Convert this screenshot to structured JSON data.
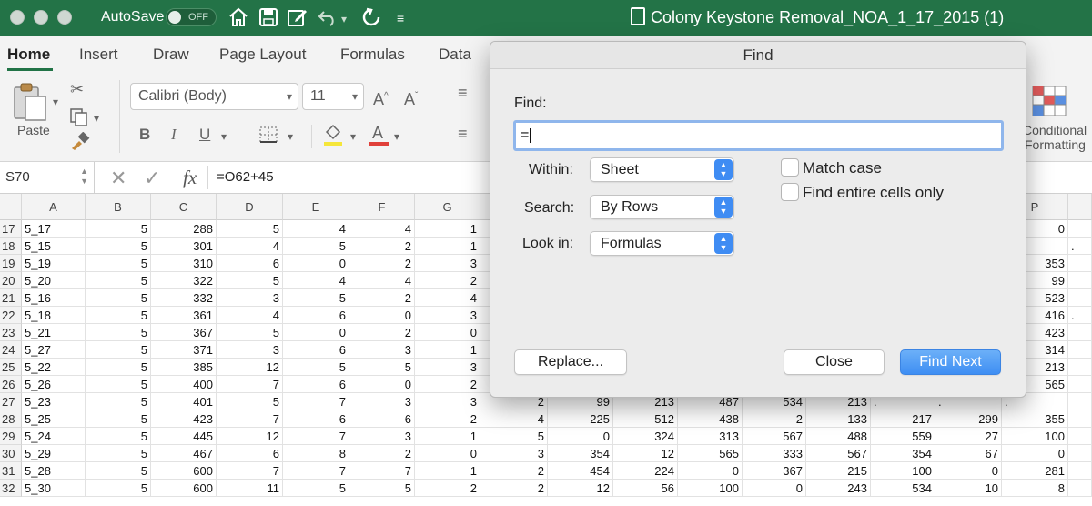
{
  "titlebar": {
    "autosave_label": "AutoSave",
    "autosave_state": "OFF",
    "document_title": "Colony Keystone Removal_NOA_1_17_2015 (1)",
    "icons": [
      "home-icon",
      "save-icon",
      "edit-icon",
      "undo-icon",
      "redo-icon",
      "customize-icon"
    ]
  },
  "ribbon": {
    "tabs": [
      "Home",
      "Insert",
      "Draw",
      "Page Layout",
      "Formulas",
      "Data"
    ],
    "active_tab": "Home",
    "paste_label": "Paste",
    "font_name": "Calibri (Body)",
    "font_size": "11",
    "bold": "B",
    "italic": "I",
    "underline": "U",
    "font_color_glyph": "A",
    "grow_font": "A",
    "shrink_font": "A",
    "conditional_formatting_line1": "Conditional",
    "conditional_formatting_line2": "Formatting"
  },
  "formula_bar": {
    "name_box": "S70",
    "fx": "fx",
    "formula": "=O62+45"
  },
  "grid": {
    "columns_left": [
      "A",
      "B",
      "C",
      "D",
      "E",
      "F",
      "G"
    ],
    "column_right": "P",
    "rows": [
      {
        "n": "17",
        "left": [
          "5_17",
          "5",
          "288",
          "5",
          "4",
          "4",
          "1"
        ],
        "right": [],
        "p": "0",
        "tail": ""
      },
      {
        "n": "18",
        "left": [
          "5_15",
          "5",
          "301",
          "4",
          "5",
          "2",
          "1"
        ],
        "right": [],
        "p": "",
        "tail": "."
      },
      {
        "n": "19",
        "left": [
          "5_19",
          "5",
          "310",
          "6",
          "0",
          "2",
          "3"
        ],
        "right": [],
        "p": "353",
        "tail": ""
      },
      {
        "n": "20",
        "left": [
          "5_20",
          "5",
          "322",
          "5",
          "4",
          "4",
          "2"
        ],
        "right": [],
        "p": "99",
        "tail": ""
      },
      {
        "n": "21",
        "left": [
          "5_16",
          "5",
          "332",
          "3",
          "5",
          "2",
          "4"
        ],
        "right": [],
        "p": "523",
        "tail": ""
      },
      {
        "n": "22",
        "left": [
          "5_18",
          "5",
          "361",
          "4",
          "6",
          "0",
          "3"
        ],
        "right": [],
        "p": "416",
        "tail": "."
      },
      {
        "n": "23",
        "left": [
          "5_21",
          "5",
          "367",
          "5",
          "0",
          "2",
          "0"
        ],
        "right": [],
        "p": "423",
        "tail": ""
      },
      {
        "n": "24",
        "left": [
          "5_27",
          "5",
          "371",
          "3",
          "6",
          "3",
          "1"
        ],
        "right": [],
        "p": "314",
        "tail": ""
      },
      {
        "n": "25",
        "left": [
          "5_22",
          "5",
          "385",
          "12",
          "5",
          "5",
          "3"
        ],
        "right": [],
        "p": "213",
        "tail": ""
      },
      {
        "n": "26",
        "left": [
          "5_26",
          "5",
          "400",
          "7",
          "6",
          "0",
          "2"
        ],
        "right": [],
        "p": "565",
        "tail": ""
      },
      {
        "n": "27",
        "left": [
          "5_23",
          "5",
          "401",
          "5",
          "7",
          "3",
          "3"
        ],
        "right": [
          "2",
          "99",
          "213",
          "487",
          "534",
          "213",
          ".",
          ".",
          "."
        ],
        "p": "",
        "tail": ""
      },
      {
        "n": "28",
        "left": [
          "5_25",
          "5",
          "423",
          "7",
          "6",
          "6",
          "2"
        ],
        "right": [
          "4",
          "225",
          "512",
          "438",
          "2",
          "133",
          "217",
          "299"
        ],
        "p": "355",
        "tail": ""
      },
      {
        "n": "29",
        "left": [
          "5_24",
          "5",
          "445",
          "12",
          "7",
          "3",
          "1"
        ],
        "right": [
          "5",
          "0",
          "324",
          "313",
          "567",
          "488",
          "559",
          "27"
        ],
        "p": "100",
        "tail": ""
      },
      {
        "n": "30",
        "left": [
          "5_29",
          "5",
          "467",
          "6",
          "8",
          "2",
          "0"
        ],
        "right": [
          "3",
          "354",
          "12",
          "565",
          "333",
          "567",
          "354",
          "67"
        ],
        "p": "0",
        "tail": ""
      },
      {
        "n": "31",
        "left": [
          "5_28",
          "5",
          "600",
          "7",
          "7",
          "7",
          "1"
        ],
        "right": [
          "2",
          "454",
          "224",
          "0",
          "367",
          "215",
          "100",
          "0"
        ],
        "p": "281",
        "tail": ""
      },
      {
        "n": "32",
        "left": [
          "5_30",
          "5",
          "600",
          "11",
          "5",
          "5",
          "2"
        ],
        "right": [
          "2",
          "12",
          "56",
          "100",
          "0",
          "243",
          "534",
          "10"
        ],
        "p": "8",
        "tail": ""
      }
    ]
  },
  "find_dialog": {
    "title": "Find",
    "find_label": "Find:",
    "find_value": "=",
    "within_label": "Within:",
    "within_value": "Sheet",
    "search_label": "Search:",
    "search_value": "By Rows",
    "lookin_label": "Look in:",
    "lookin_value": "Formulas",
    "match_case_label": "Match case",
    "entire_cells_label": "Find entire cells only",
    "replace_button": "Replace...",
    "close_button": "Close",
    "find_next_button": "Find Next"
  }
}
